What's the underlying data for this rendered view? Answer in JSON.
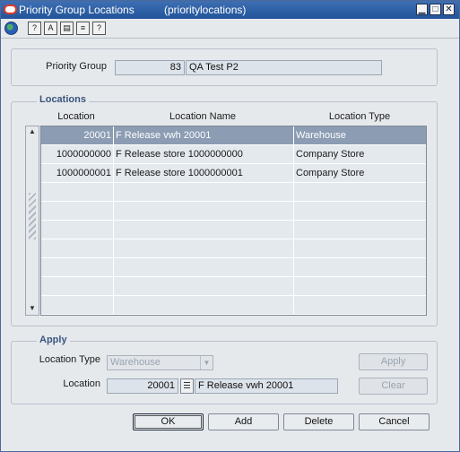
{
  "window": {
    "title": "Priority Group Locations",
    "subtitle": "(prioritylocations)",
    "minimize_glyph": "▁",
    "maximize_glyph": "□",
    "close_glyph": "✕"
  },
  "toolbar": {
    "icons": [
      "globe-icon",
      "help-icon",
      "spell-icon",
      "calculator-icon",
      "notes-icon",
      "context-help-icon"
    ],
    "glyphs": [
      "?",
      "A",
      "▤",
      "≡",
      "?"
    ]
  },
  "header": {
    "priority_group_label": "Priority Group",
    "priority_group_id": "83",
    "priority_group_name": "QA Test P2"
  },
  "locations": {
    "section_title": "Locations",
    "columns": [
      "Location",
      "Location Name",
      "Location Type"
    ],
    "rows": [
      {
        "location": "20001",
        "name": "F Release vwh 20001",
        "type": "Warehouse"
      },
      {
        "location": "1000000000",
        "name": "F Release store 1000000000",
        "type": "Company Store"
      },
      {
        "location": "1000000001",
        "name": "F Release store 1000000001",
        "type": "Company Store"
      }
    ],
    "empty_rows": 7,
    "selected_row": 0,
    "scroll_up": "▲",
    "scroll_down": "▼"
  },
  "apply": {
    "section_title": "Apply",
    "location_type_label": "Location Type",
    "location_type_value": "Warehouse",
    "location_label": "Location",
    "location_id": "20001",
    "location_name": "F Release vwh 20001",
    "apply_button": "Apply",
    "clear_button": "Clear"
  },
  "footer": {
    "ok": "OK",
    "add": "Add",
    "delete": "Delete",
    "cancel": "Cancel"
  },
  "colors": {
    "title_bar": "#21549a",
    "selected_row": "#8b9cb3",
    "section_title": "#3a5580"
  }
}
